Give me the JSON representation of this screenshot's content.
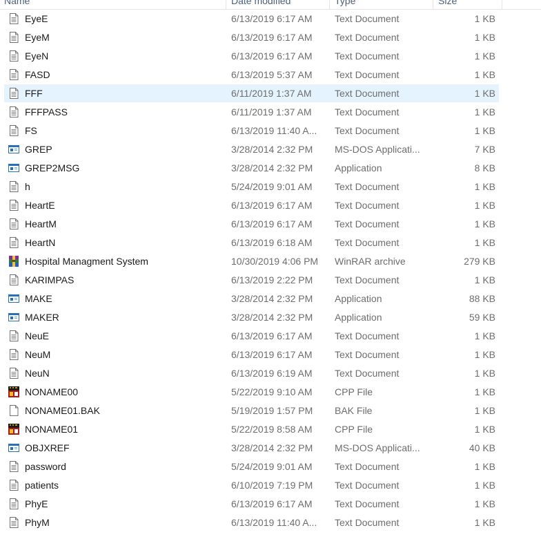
{
  "headers": {
    "name": "Name",
    "date": "Date modified",
    "type": "Type",
    "size": "Size"
  },
  "colors": {
    "selected_row": "#e5f3ff",
    "header_text": "#4c607a",
    "meta_text": "#6d6d6d"
  },
  "files": [
    {
      "name": "EyeE",
      "date": "6/13/2019 6:17 AM",
      "type": "Text Document",
      "size": "1 KB",
      "icon": "text-document-icon"
    },
    {
      "name": "EyeM",
      "date": "6/13/2019 6:17 AM",
      "type": "Text Document",
      "size": "1 KB",
      "icon": "text-document-icon"
    },
    {
      "name": "EyeN",
      "date": "6/13/2019 6:17 AM",
      "type": "Text Document",
      "size": "1 KB",
      "icon": "text-document-icon"
    },
    {
      "name": "FASD",
      "date": "6/13/2019 5:37 AM",
      "type": "Text Document",
      "size": "1 KB",
      "icon": "text-document-icon"
    },
    {
      "name": "FFF",
      "date": "6/11/2019 1:37 AM",
      "type": "Text Document",
      "size": "1 KB",
      "icon": "text-document-icon",
      "selected": true
    },
    {
      "name": "FFFPASS",
      "date": "6/11/2019 1:37 AM",
      "type": "Text Document",
      "size": "1 KB",
      "icon": "text-document-icon"
    },
    {
      "name": "FS",
      "date": "6/13/2019 11:40 A...",
      "type": "Text Document",
      "size": "1 KB",
      "icon": "text-document-icon"
    },
    {
      "name": "GREP",
      "date": "3/28/2014 2:32 PM",
      "type": "MS-DOS Applicati...",
      "size": "7 KB",
      "icon": "application-icon"
    },
    {
      "name": "GREP2MSG",
      "date": "3/28/2014 2:32 PM",
      "type": "Application",
      "size": "8 KB",
      "icon": "application-icon"
    },
    {
      "name": "h",
      "date": "5/24/2019 9:01 AM",
      "type": "Text Document",
      "size": "1 KB",
      "icon": "text-document-icon"
    },
    {
      "name": "HeartE",
      "date": "6/13/2019 6:17 AM",
      "type": "Text Document",
      "size": "1 KB",
      "icon": "text-document-icon"
    },
    {
      "name": "HeartM",
      "date": "6/13/2019 6:17 AM",
      "type": "Text Document",
      "size": "1 KB",
      "icon": "text-document-icon"
    },
    {
      "name": "HeartN",
      "date": "6/13/2019 6:18 AM",
      "type": "Text Document",
      "size": "1 KB",
      "icon": "text-document-icon"
    },
    {
      "name": "Hospital Managment System",
      "date": "10/30/2019 4:06 PM",
      "type": "WinRAR archive",
      "size": "279 KB",
      "icon": "winrar-archive-icon"
    },
    {
      "name": "KARIMPAS",
      "date": "6/13/2019 2:22 PM",
      "type": "Text Document",
      "size": "1 KB",
      "icon": "text-document-icon"
    },
    {
      "name": "MAKE",
      "date": "3/28/2014 2:32 PM",
      "type": "Application",
      "size": "88 KB",
      "icon": "application-icon"
    },
    {
      "name": "MAKER",
      "date": "3/28/2014 2:32 PM",
      "type": "Application",
      "size": "59 KB",
      "icon": "application-icon"
    },
    {
      "name": "NeuE",
      "date": "6/13/2019 6:17 AM",
      "type": "Text Document",
      "size": "1 KB",
      "icon": "text-document-icon"
    },
    {
      "name": "NeuM",
      "date": "6/13/2019 6:17 AM",
      "type": "Text Document",
      "size": "1 KB",
      "icon": "text-document-icon"
    },
    {
      "name": "NeuN",
      "date": "6/13/2019 6:19 AM",
      "type": "Text Document",
      "size": "1 KB",
      "icon": "text-document-icon"
    },
    {
      "name": "NONAME00",
      "date": "5/22/2019 9:10 AM",
      "type": "CPP File",
      "size": "1 KB",
      "icon": "cpp-file-icon"
    },
    {
      "name": "NONAME01.BAK",
      "date": "5/19/2019 1:57 PM",
      "type": "BAK File",
      "size": "1 KB",
      "icon": "blank-file-icon"
    },
    {
      "name": "NONAME01",
      "date": "5/22/2019 8:58 AM",
      "type": "CPP File",
      "size": "1 KB",
      "icon": "cpp-file-icon"
    },
    {
      "name": "OBJXREF",
      "date": "3/28/2014 2:32 PM",
      "type": "MS-DOS Applicati...",
      "size": "40 KB",
      "icon": "application-icon"
    },
    {
      "name": "password",
      "date": "5/24/2019 9:01 AM",
      "type": "Text Document",
      "size": "1 KB",
      "icon": "text-document-icon"
    },
    {
      "name": "patients",
      "date": "6/10/2019 7:19 PM",
      "type": "Text Document",
      "size": "1 KB",
      "icon": "text-document-icon"
    },
    {
      "name": "PhyE",
      "date": "6/13/2019 6:17 AM",
      "type": "Text Document",
      "size": "1 KB",
      "icon": "text-document-icon"
    },
    {
      "name": "PhyM",
      "date": "6/13/2019 11:40 A...",
      "type": "Text Document",
      "size": "1 KB",
      "icon": "text-document-icon"
    }
  ]
}
